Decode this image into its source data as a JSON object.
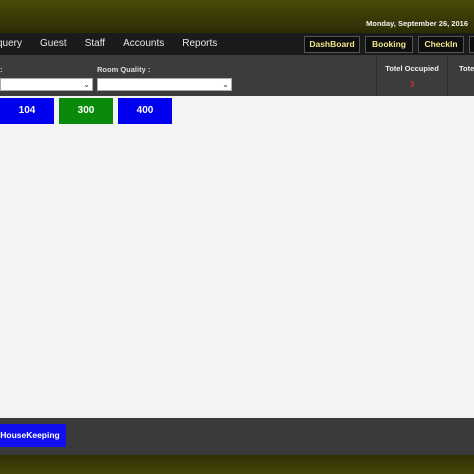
{
  "header": {
    "date": "Monday, September 26, 2016"
  },
  "nav": {
    "items": [
      "query",
      "Guest",
      "Staff",
      "Accounts",
      "Reports"
    ],
    "buttons": [
      "DashBoard",
      "Booking",
      "CheckIn"
    ]
  },
  "filters": {
    "room_type_label": ":",
    "room_quality_label": "Room Quality :"
  },
  "stats": {
    "total_occupied_label": "Totel Occupied",
    "total_occupied_value": "3",
    "total_second_label": "Tote"
  },
  "rooms": [
    {
      "number": "104",
      "color": "#0000ee"
    },
    {
      "number": "300",
      "color": "#0a8a0a"
    },
    {
      "number": "400",
      "color": "#0000ee"
    }
  ],
  "footer": {
    "housekeeping_label": "HouseKeeping"
  },
  "colors": {
    "accent_gold": "#f0e68c",
    "occupied_red": "#ff2b2b",
    "room_available": "#0000ee",
    "room_green": "#0a8a0a"
  }
}
